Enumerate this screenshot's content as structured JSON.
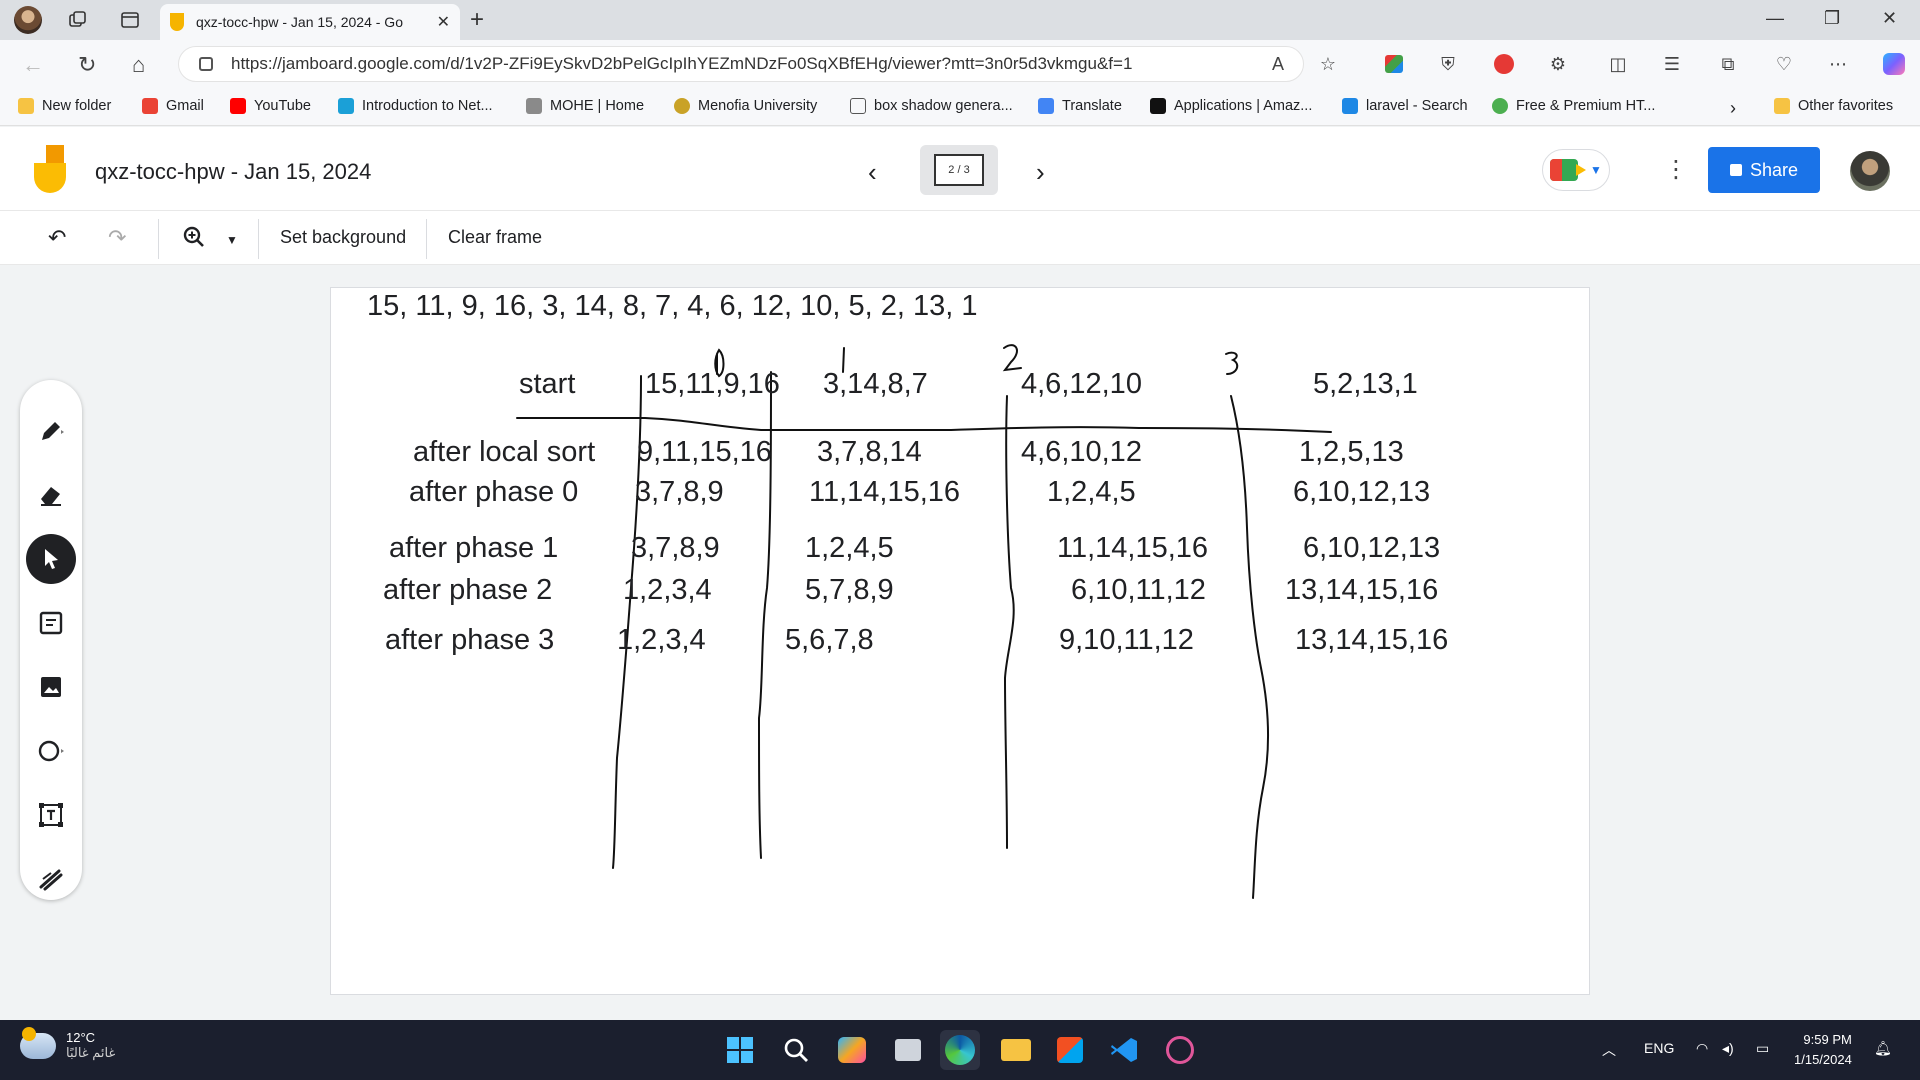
{
  "browser": {
    "tab_title": "qxz-tocc-hpw - Jan 15, 2024 - Go",
    "url": "https://jamboard.google.com/d/1v2P-ZFi9EySkvD2bPelGcIpIhYEZmNDzFo0SqXBfEHg/viewer?mtt=3n0r5d3vkmgu&f=1",
    "bookmarks": [
      {
        "label": "New folder",
        "icon": "folder-icon",
        "color": "#f6c343"
      },
      {
        "label": "Gmail",
        "icon": "gmail-icon",
        "color": "#ea4335"
      },
      {
        "label": "YouTube",
        "icon": "youtube-icon",
        "color": "#ff0000"
      },
      {
        "label": "Introduction to Net...",
        "icon": "cisco-icon",
        "color": "#1ba0d7"
      },
      {
        "label": "MOHE | Home",
        "icon": "mohe-icon",
        "color": "#8a8a8a"
      },
      {
        "label": "Menofia University",
        "icon": "university-icon",
        "color": "#c9a227"
      },
      {
        "label": "box shadow genera...",
        "icon": "page-icon",
        "color": "#555555"
      },
      {
        "label": "Translate",
        "icon": "translate-icon",
        "color": "#4285f4"
      },
      {
        "label": "Applications | Amaz...",
        "icon": "amazon-icon",
        "color": "#111111"
      },
      {
        "label": "laravel - Search",
        "icon": "bing-icon",
        "color": "#1e88e5"
      },
      {
        "label": "Free & Premium HT...",
        "icon": "leaf-icon",
        "color": "#4caf50"
      }
    ],
    "other_favorites": "Other favorites"
  },
  "jamboard": {
    "title": "qxz-tocc-hpw - Jan 15, 2024",
    "frame_indicator": "2 / 3",
    "share_label": "Share",
    "toolbar": {
      "set_background": "Set background",
      "clear_frame": "Clear frame"
    },
    "colors": {
      "share": "#1a73e8",
      "logo": "#fbbc04"
    }
  },
  "canvas": {
    "sequence": "15, 11, 9, 16, 3, 14, 8, 7, 4, 6, 12, 10, 5, 2, 13, 1",
    "column_heads": [
      "0",
      "1",
      "2",
      "3"
    ],
    "row_labels": [
      "start",
      "after local sort",
      "after phase 0",
      "after phase 1",
      "after phase 2",
      "after phase 3"
    ],
    "cells": [
      [
        "15,11,9,16",
        "3,14,8,7",
        "4,6,12,10",
        "5,2,13,1"
      ],
      [
        "9,11,15,16",
        "3,7,8,14",
        "4,6,10,12",
        "1,2,5,13"
      ],
      [
        "3,7,8,9",
        "11,14,15,16",
        "1,2,4,5",
        "6,10,12,13"
      ],
      [
        "3,7,8,9",
        "1,2,4,5",
        "11,14,15,16",
        "6,10,12,13"
      ],
      [
        "1,2,3,4",
        "5,7,8,9",
        "6,10,11,12",
        "13,14,15,16"
      ],
      [
        "1,2,3,4",
        "5,6,7,8",
        "9,10,11,12",
        "13,14,15,16"
      ]
    ]
  },
  "taskbar": {
    "temperature": "12°C",
    "weather_text": "غائم غالبًا",
    "language": "ENG",
    "time": "9:59 PM",
    "date": "1/15/2024"
  }
}
